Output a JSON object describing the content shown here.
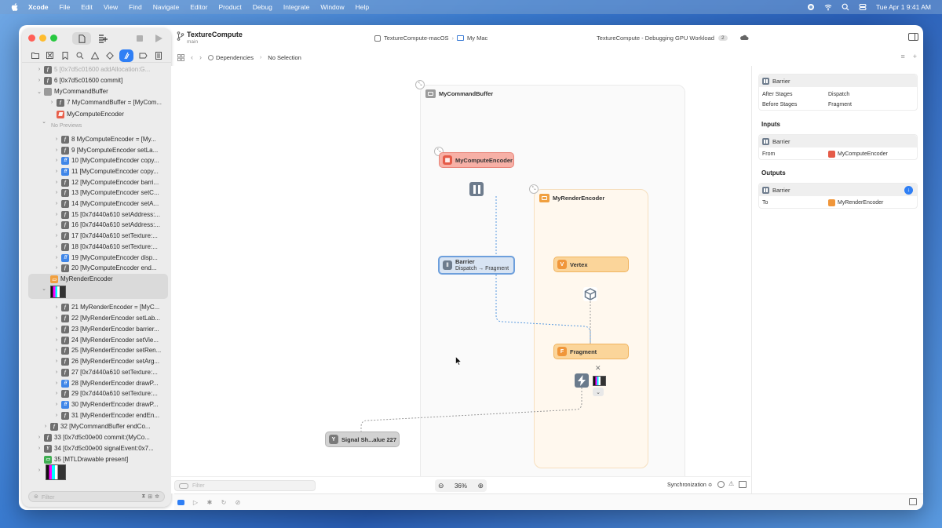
{
  "menubar": {
    "app": "Xcode",
    "items": [
      "File",
      "Edit",
      "View",
      "Find",
      "Navigate",
      "Editor",
      "Product",
      "Debug",
      "Integrate",
      "Window",
      "Help"
    ],
    "clock": "Tue Apr 1  9:41 AM"
  },
  "toolbar": {
    "project": "TextureCompute",
    "branch": "main",
    "scheme": "TextureCompute-macOS",
    "destination": "My Mac",
    "status": "TextureCompute - Debugging GPU Workload",
    "status_count": "2"
  },
  "jumpbar": {
    "item1": "Dependencies",
    "item2": "No Selection"
  },
  "navigator": {
    "no_previews": "No Previews",
    "filter_placeholder": "Filter",
    "rows": [
      {
        "label": "5 [0x7d5c01600 addAllocation:G...",
        "badge": "gray"
      },
      {
        "label": "6 [0x7d5c01600 commit]",
        "badge": "gray"
      },
      {
        "label": "MyCommandBuffer",
        "badge": "cmdbuf"
      },
      {
        "label": "7 MyCommandBuffer = [MyCom...",
        "badge": "gray"
      },
      {
        "label": "MyComputeEncoder",
        "badge": "red"
      },
      {
        "label": "8 MyComputeEncoder = [My...",
        "badge": "gray"
      },
      {
        "label": "9 [MyComputeEncoder setLa...",
        "badge": "gray"
      },
      {
        "label": "10 [MyComputeEncoder copy...",
        "badge": "blue"
      },
      {
        "label": "11 [MyComputeEncoder copy...",
        "badge": "blue"
      },
      {
        "label": "12 [MyComputeEncoder barri...",
        "badge": "gray"
      },
      {
        "label": "13 [MyComputeEncoder setC...",
        "badge": "gray"
      },
      {
        "label": "14 [MyComputeEncoder setA...",
        "badge": "gray"
      },
      {
        "label": "15 [0x7d440a610 setAddress:...",
        "badge": "gray"
      },
      {
        "label": "16 [0x7d440a610 setAddress:...",
        "badge": "gray"
      },
      {
        "label": "17 [0x7d440a610 setTexture:...",
        "badge": "gray"
      },
      {
        "label": "18 [0x7d440a610 setTexture:...",
        "badge": "gray"
      },
      {
        "label": "19 [MyComputeEncoder disp...",
        "badge": "blue"
      },
      {
        "label": "20 [MyComputeEncoder end...",
        "badge": "gray"
      },
      {
        "label": "MyRenderEncoder",
        "badge": "orange"
      },
      {
        "label": "21 MyRenderEncoder = [MyC...",
        "badge": "gray"
      },
      {
        "label": "22 [MyRenderEncoder setLab...",
        "badge": "gray"
      },
      {
        "label": "23 [MyRenderEncoder barrier...",
        "badge": "gray"
      },
      {
        "label": "24 [MyRenderEncoder setVie...",
        "badge": "gray"
      },
      {
        "label": "25 [MyRenderEncoder setRen...",
        "badge": "gray"
      },
      {
        "label": "26 [MyRenderEncoder setArg...",
        "badge": "gray"
      },
      {
        "label": "27 [0x7d440a610 setTexture:...",
        "badge": "gray"
      },
      {
        "label": "28 [MyRenderEncoder drawP...",
        "badge": "blue"
      },
      {
        "label": "29 [0x7d440a610 setTexture:...",
        "badge": "gray"
      },
      {
        "label": "30 [MyRenderEncoder drawP...",
        "badge": "blue"
      },
      {
        "label": "31 [MyRenderEncoder endEn...",
        "badge": "gray"
      },
      {
        "label": "32 [MyCommandBuffer endCo...",
        "badge": "gray"
      },
      {
        "label": "33 [0x7d5c00e00 commit:(MyCo...",
        "badge": "gray"
      },
      {
        "label": "34 [0x7d5c00e00 signalEvent:0x7...",
        "badge": "gray"
      },
      {
        "label": "35 [MTLDrawable present]",
        "badge": "green"
      }
    ]
  },
  "graph": {
    "command_buffer": "MyCommandBuffer",
    "compute_encoder": "MyComputeEncoder",
    "render_encoder": "MyRenderEncoder",
    "barrier_title": "Barrier",
    "barrier_sub": "Dispatch → Fragment",
    "vertex": "Vertex",
    "fragment": "Fragment",
    "signal": "Signal Sh...alue 227",
    "vertex_letter": "V",
    "fragment_letter": "F"
  },
  "canvas_bottom": {
    "filter_placeholder": "Filter",
    "zoom": "36%",
    "sync": "Synchronization ≎"
  },
  "inspector": {
    "header": "Barrier",
    "after_stages_key": "After Stages",
    "after_stages_val": "Dispatch",
    "before_stages_key": "Before Stages",
    "before_stages_val": "Fragment",
    "inputs_title": "Inputs",
    "inputs_header": "Barrier",
    "from_key": "From",
    "from_val": "MyComputeEncoder",
    "outputs_title": "Outputs",
    "outputs_header": "Barrier",
    "to_key": "To",
    "to_val": "MyRenderEncoder"
  },
  "colors": {
    "accent": "#2f7ff5",
    "compute": "#f7b0a6",
    "render": "#fbd59a",
    "barrier": "#d8e4f3"
  }
}
